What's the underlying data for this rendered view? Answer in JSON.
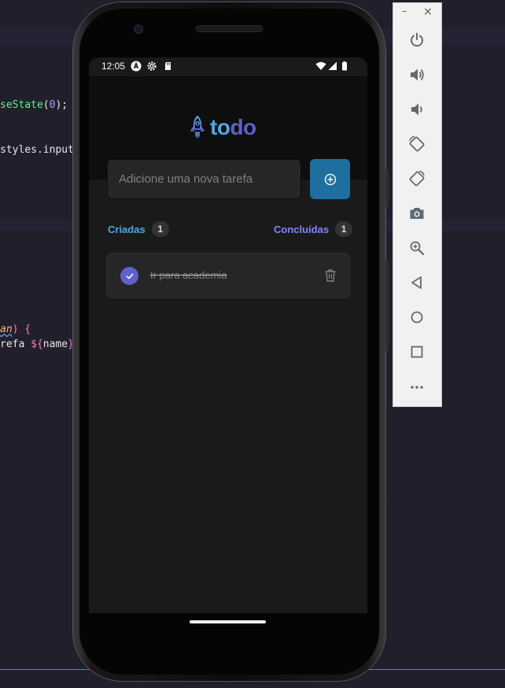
{
  "editor": {
    "lines": [
      {
        "parts": [
          {
            "t": "seState",
            "c": "c-fn"
          },
          {
            "t": "(",
            "c": ""
          },
          {
            "t": "0",
            "c": "c-num"
          },
          {
            "t": ");",
            "c": ""
          }
        ]
      },
      {
        "parts": [
          {
            "t": "styles.input",
            "c": ""
          }
        ]
      },
      {
        "parts": [
          {
            "t": "an",
            "c": "c-param"
          },
          {
            "t": ") {",
            "c": "c-kw"
          }
        ]
      },
      {
        "parts": [
          {
            "t": "refa ",
            "c": ""
          },
          {
            "t": "${",
            "c": "c-kw"
          },
          {
            "t": "name",
            "c": ""
          },
          {
            "t": "}",
            "c": "c-kw"
          }
        ]
      }
    ]
  },
  "status_bar": {
    "time": "12:05"
  },
  "app": {
    "logo": {
      "part1": "to",
      "part2": "do"
    },
    "input": {
      "placeholder": "Adicione uma nova tarefa",
      "value": ""
    },
    "counters": {
      "created_label": "Criadas",
      "created_count": "1",
      "done_label": "Concluídas",
      "done_count": "1"
    },
    "tasks": [
      {
        "text": "Ir para academia",
        "completed": true
      }
    ]
  },
  "toolbar": {
    "minimize": "–",
    "close": "×",
    "buttons": [
      "power-icon",
      "volume-up-icon",
      "volume-down-icon",
      "rotate-left-icon",
      "rotate-right-icon",
      "camera-icon",
      "zoom-icon",
      "back-icon",
      "home-icon",
      "overview-icon",
      "more-icon"
    ]
  },
  "colors": {
    "blue": "#4ea8de",
    "purple": "#5e60ce",
    "purple_light": "#8284fa",
    "button_blue": "#1e6f9f"
  }
}
